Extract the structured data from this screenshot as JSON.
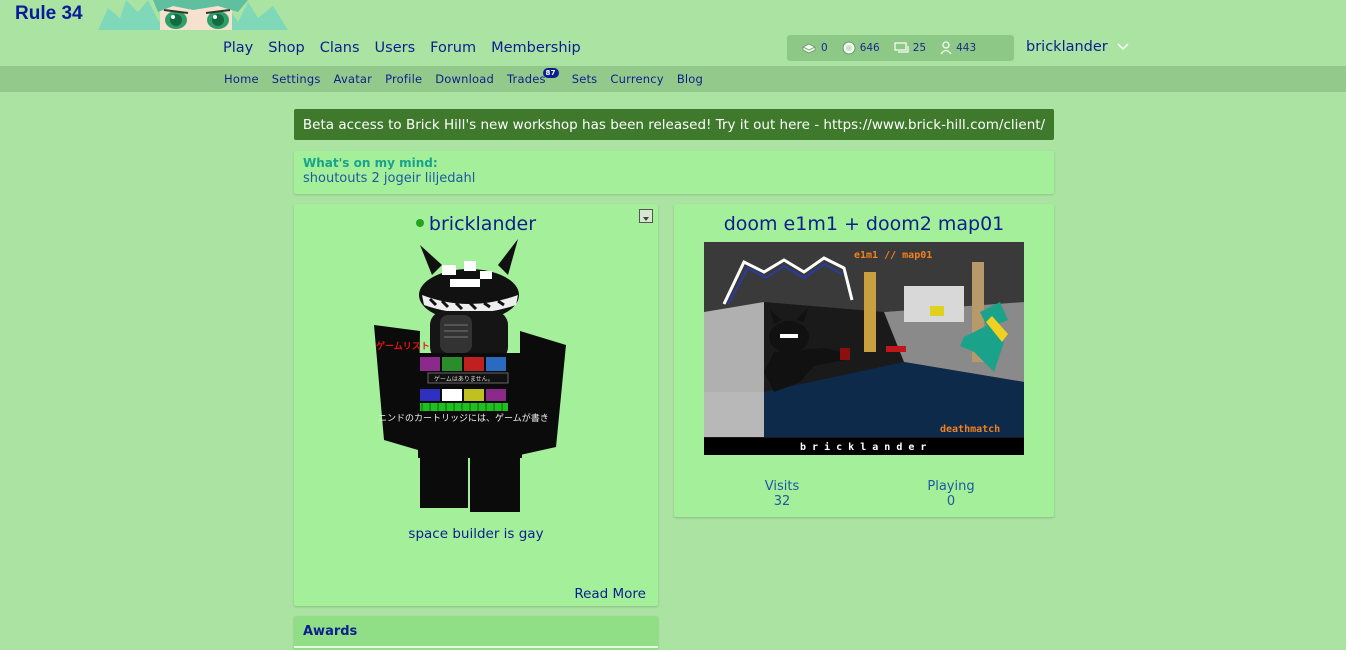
{
  "header": {
    "logo": "Rule 34",
    "nav": [
      "Play",
      "Shop",
      "Clans",
      "Users",
      "Forum",
      "Membership"
    ],
    "stats": {
      "bricks": "0",
      "bits": "646",
      "messages": "25",
      "friends": "443"
    },
    "username": "bricklander"
  },
  "subnav": {
    "items": [
      "Home",
      "Settings",
      "Avatar",
      "Profile",
      "Download",
      "Trades",
      "Sets",
      "Currency",
      "Blog"
    ],
    "trades_badge": "87"
  },
  "alert": {
    "text": "Beta access to Brick Hill's new workshop has been released! Try it out here - https://www.brick-hill.com/client/"
  },
  "status": {
    "label": "What's on my mind:",
    "text": "shoutouts 2 jogeir liljedahl"
  },
  "profile": {
    "name": "bricklander",
    "online": true,
    "blurb": "space builder is gay",
    "read_more": "Read More"
  },
  "game": {
    "title": "doom e1m1 + doom2 map01",
    "thumb_text_top": "e1m1 // map01",
    "thumb_text_mode": "deathmatch",
    "thumb_text_author": "b r i c k l a n d e r",
    "visits_label": "Visits",
    "visits_value": "32",
    "playing_label": "Playing",
    "playing_value": "0"
  },
  "awards": {
    "title": "Awards"
  },
  "colors": {
    "background": "#abe3a2",
    "subnav": "#93c98b",
    "card": "#a3ef9a",
    "alert": "#3f7a2c",
    "link": "#0d1f8e"
  }
}
